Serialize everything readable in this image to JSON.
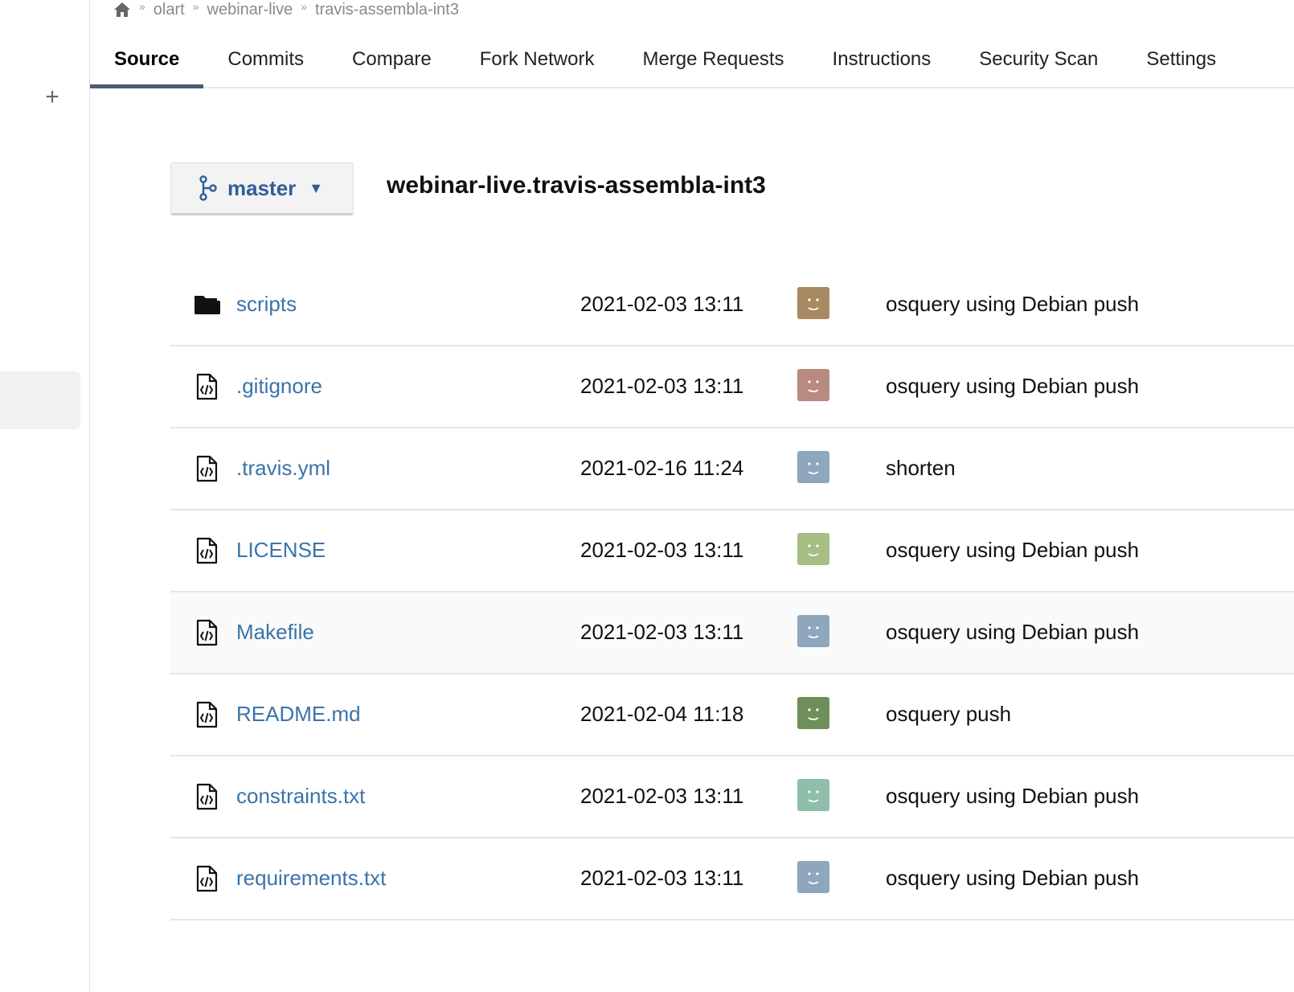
{
  "breadcrumb": {
    "home_icon": "home-icon",
    "items": [
      "olart",
      "webinar-live",
      "travis-assembla-int3"
    ],
    "separator": "»"
  },
  "sidebar": {
    "add_icon": "plus-icon",
    "add_glyph": "+"
  },
  "tabs": [
    {
      "label": "Source",
      "active": true
    },
    {
      "label": "Commits"
    },
    {
      "label": "Compare"
    },
    {
      "label": "Fork Network"
    },
    {
      "label": "Merge Requests"
    },
    {
      "label": "Instructions"
    },
    {
      "label": "Security Scan"
    },
    {
      "label": "Settings"
    }
  ],
  "branch": {
    "label": "master",
    "icon": "branch-icon",
    "caret": "▼"
  },
  "repo_title": "webinar-live.travis-assembla-int3",
  "files": [
    {
      "name": "scripts",
      "type": "folder",
      "date": "2021-02-03 13:11",
      "avatar_color": "#a88a62",
      "message": "osquery using Debian push"
    },
    {
      "name": ".gitignore",
      "type": "file",
      "date": "2021-02-03 13:11",
      "avatar_color": "#b98a80",
      "message": "osquery using Debian push"
    },
    {
      "name": ".travis.yml",
      "type": "file",
      "date": "2021-02-16 11:24",
      "avatar_color": "#8ea7bd",
      "message": "shorten"
    },
    {
      "name": "LICENSE",
      "type": "file",
      "date": "2021-02-03 13:11",
      "avatar_color": "#a6bd84",
      "message": "osquery using Debian push"
    },
    {
      "name": "Makefile",
      "type": "file",
      "date": "2021-02-03 13:11",
      "avatar_color": "#8ea7bd",
      "message": "osquery using Debian push"
    },
    {
      "name": "README.md",
      "type": "file",
      "date": "2021-02-04 11:18",
      "avatar_color": "#6f8f5a",
      "message": "osquery push"
    },
    {
      "name": "constraints.txt",
      "type": "file",
      "date": "2021-02-03 13:11",
      "avatar_color": "#8fbfaa",
      "message": "osquery using Debian push"
    },
    {
      "name": "requirements.txt",
      "type": "file",
      "date": "2021-02-03 13:11",
      "avatar_color": "#8ea7bd",
      "message": "osquery using Debian push"
    }
  ]
}
